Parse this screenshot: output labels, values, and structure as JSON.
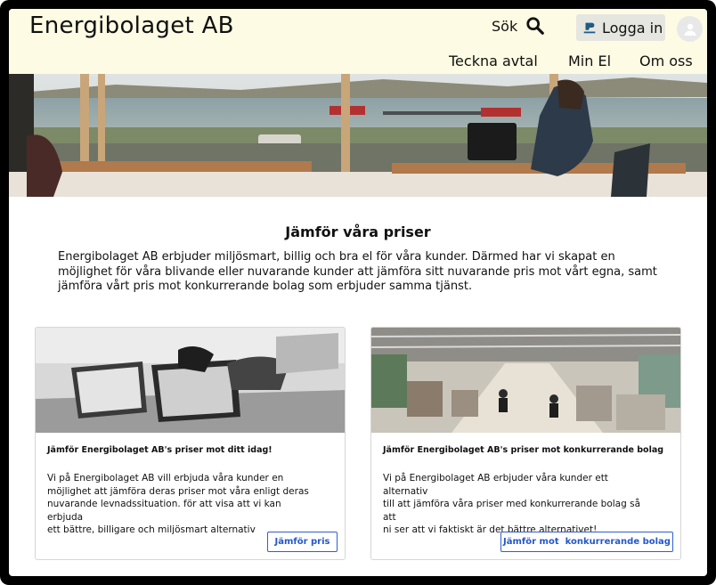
{
  "header": {
    "brand": "Energibolaget AB",
    "search_label": "Sök",
    "login_label": "Logga in"
  },
  "nav": [
    {
      "label": "Teckna avtal"
    },
    {
      "label": "Min El"
    },
    {
      "label": "Om oss"
    }
  ],
  "intro": {
    "title": "Jämför våra priser",
    "text": "Energibolaget AB erbjuder miljösmart, billig och bra el för våra kunder. Därmed har vi skapat en möjlighet för våra blivande eller nuvarande kunder att jämföra sitt nuvarande pris mot vårt egna, samt jämföra vårt pris mot konkurrerande bolag som erbjuder samma tjänst."
  },
  "cards": [
    {
      "title": "Jämför Energibolaget AB's priser mot ditt idag!",
      "text": "Vi på Energibolaget AB vill erbjuda våra kunder en\nmöjlighet att jämföra deras priser mot våra enligt deras\nnuvarande levnadssituation. för att visa att vi kan erbjuda\nett bättre, billigare och miljösmart alternativ",
      "button": "Jämför pris"
    },
    {
      "title": "Jämför Energibolaget AB's priser mot konkurrerande bolag",
      "text": "Vi på Energibolaget AB erbjuder våra kunder ett alternativ\ntill att jämföra våra priser med konkurrerande bolag så att\nni ser att vi faktiskt är det bättre alternativet!",
      "button": "Jämför mot  konkurrerande bolag"
    }
  ],
  "colors": {
    "header_bg": "#fdfbe3",
    "button_blue": "#2f5fd0",
    "frame": "#000000"
  },
  "icons": {
    "search": "search-icon",
    "login": "bankid-icon",
    "avatar": "user-icon"
  }
}
